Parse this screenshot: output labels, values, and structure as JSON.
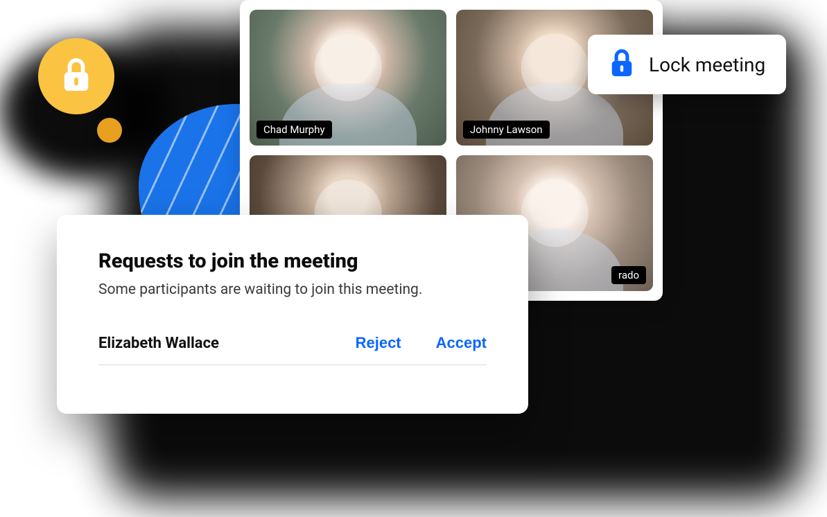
{
  "lock_callout": {
    "label": "Lock meeting"
  },
  "participants": [
    {
      "name": "Chad Murphy"
    },
    {
      "name": "Johnny Lawson"
    },
    {
      "name": ""
    },
    {
      "name": "rado"
    }
  ],
  "join_requests": {
    "title": "Requests to join the meeting",
    "subtitle": "Some participants are waiting to join this meeting.",
    "items": [
      {
        "name": "Elizabeth Wallace",
        "reject_label": "Reject",
        "accept_label": "Accept"
      }
    ]
  },
  "colors": {
    "accent_blue": "#0b66ff",
    "badge_yellow": "#fbc342"
  }
}
